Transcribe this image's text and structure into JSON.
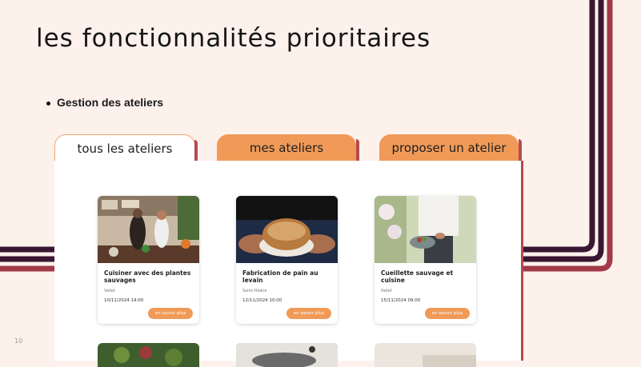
{
  "slide": {
    "title": "les fonctionnalités prioritaires",
    "bullet": "Gestion des ateliers",
    "page_number": "10"
  },
  "tabs": [
    {
      "label": "tous les ateliers",
      "active": true
    },
    {
      "label": "mes ateliers",
      "active": false
    },
    {
      "label": "proposer un atelier",
      "active": false
    }
  ],
  "cards": [
    {
      "title": "Cuisiner avec des plantes sauvages",
      "location": "Vallet",
      "date": "10/11/2024 14:00",
      "button": "en savoir plus",
      "image": "cooking-photo"
    },
    {
      "title": "Fabrication de pain au levain",
      "location": "Saint-Hilaire",
      "date": "12/11/2024 10:00",
      "button": "en savoir plus",
      "image": "bread-photo"
    },
    {
      "title": "Cueillette sauvage et cuisine",
      "location": "Pallet",
      "date": "15/11/2024 09:00",
      "button": "en savoir plus",
      "image": "foraging-photo"
    }
  ],
  "colors": {
    "background": "#fdf1ec",
    "accent": "#f19a58",
    "stripe_dark": "#3a1632",
    "stripe_red": "#a23a4a"
  }
}
